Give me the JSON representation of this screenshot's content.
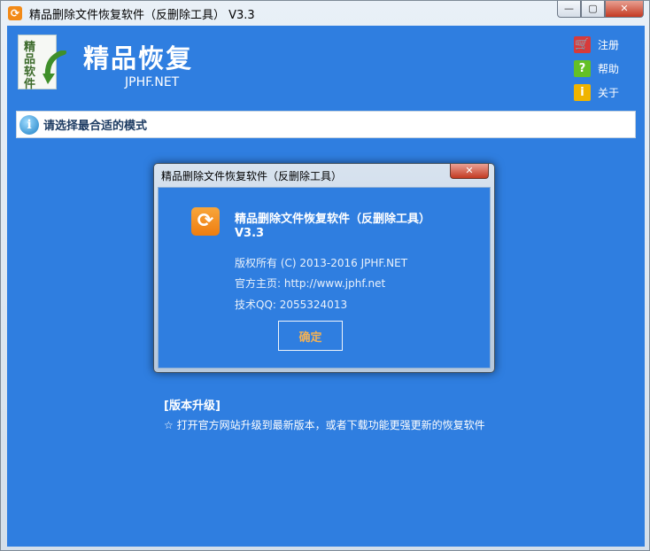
{
  "window": {
    "title": "精品删除文件恢复软件（反删除工具） V3.3",
    "minimize": "—",
    "maximize": "▢",
    "close": "✕"
  },
  "header": {
    "logo_chars": [
      "精",
      "品",
      "软",
      "件"
    ],
    "brand_title": "精品恢复",
    "brand_sub": "JPHF.NET"
  },
  "top_links": [
    {
      "icon": "cart-icon",
      "label": "注册"
    },
    {
      "icon": "help-icon",
      "label": "帮助"
    },
    {
      "icon": "info-icon",
      "label": "关于"
    }
  ],
  "mode_bar": {
    "icon": "info-circle-icon",
    "text": "请选择最合适的模式"
  },
  "upgrade": {
    "title": "[版本升级]",
    "description": "☆ 打开官方网站升级到最新版本，或者下载功能更强更新的恢复软件"
  },
  "about_dialog": {
    "title": "精品删除文件恢复软件（反删除工具）",
    "close": "✕",
    "app_name": "精品删除文件恢复软件（反删除工具）",
    "version": "V3.3",
    "copyright": "版权所有 (C) 2013-2016 JPHF.NET",
    "homepage": "官方主页: http://www.jphf.net",
    "qq": "技术QQ: 2055324013",
    "ok_label": "确定"
  },
  "colors": {
    "client_bg": "#2f7ee0",
    "accent_orange": "#f28a17",
    "ok_text": "#f2b155"
  }
}
